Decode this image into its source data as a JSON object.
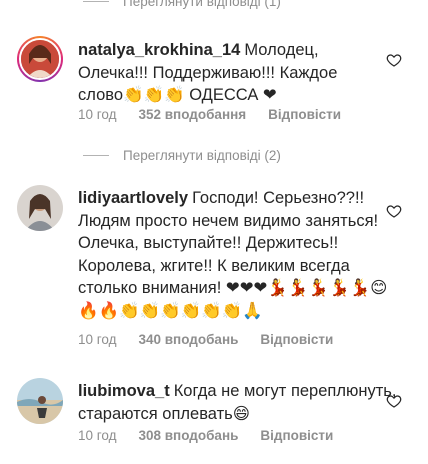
{
  "top_view_replies": {
    "label": "Переглянути відповіді (1)"
  },
  "comments": [
    {
      "username": "natalya_krokhina_14",
      "text": "Молодец, Олечка!!! Поддерживаю!!! Каждое слово👏👏👏 ОДЕССА ❤",
      "time": "10 год",
      "likes": "352 вподобання",
      "reply": "Відповісти",
      "view_replies": "Переглянути відповіді (2)"
    },
    {
      "username": "lidiyaartlovely",
      "text": "Господи! Серьезно??!! Людям просто нечем видимо заняться! Олечка, выступайте!! Держитесь!! Королева, жгите!! К великим всегда столько внимания! ❤❤❤💃💃💃💃💃😊🔥🔥👏👏👏👏👏👏🙏",
      "time": "10 год",
      "likes": "340 вподобань",
      "reply": "Відповісти"
    },
    {
      "username": "liubimova_t",
      "text": "Когда не могут переплюнуть, стараются оплевать😄",
      "time": "10 год",
      "likes": "308 вподобань",
      "reply": "Відповісти"
    }
  ],
  "icons": {
    "like": "heart-outline-icon"
  },
  "colors": {
    "text": "#262626",
    "muted": "#8e8e8e",
    "heart": "#ed4956"
  }
}
